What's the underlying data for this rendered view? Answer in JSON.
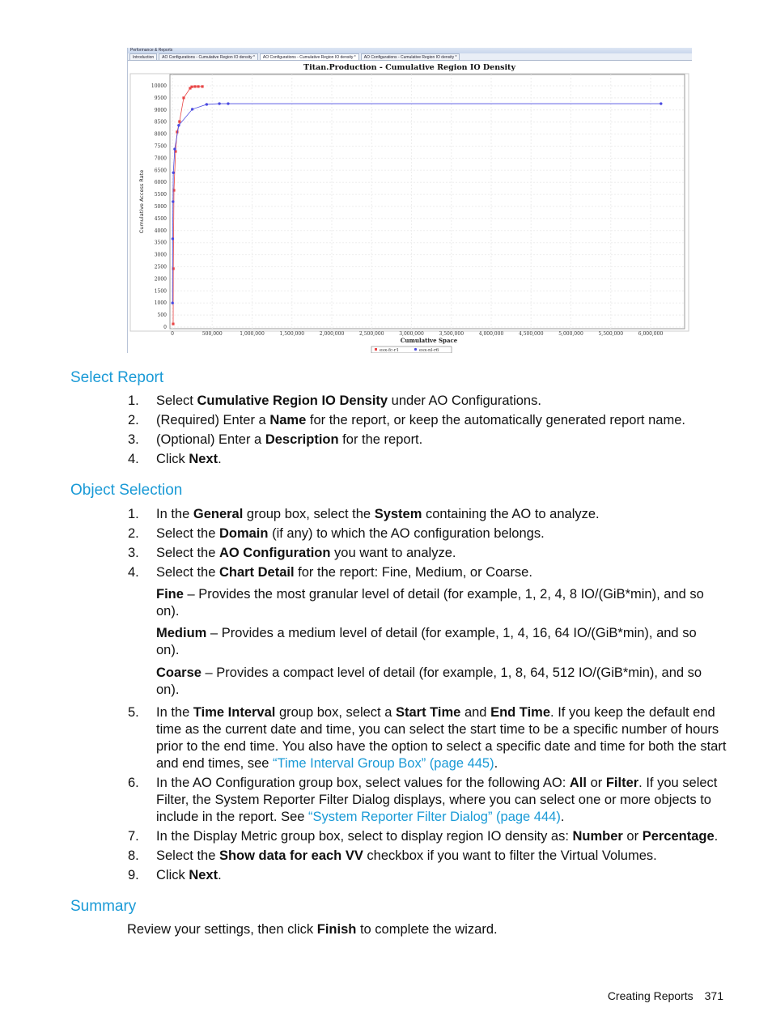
{
  "screenshot": {
    "window_title": "Performance & Reports",
    "tabs": [
      "Introduction",
      "AO Configurations - Cumulative Region IO density *",
      "AO Configurations - Cumulative Region IO density *",
      "AO Configurations - Cumulative Region IO density *"
    ],
    "active_tab": 2
  },
  "chart_data": {
    "type": "line",
    "title": "Titan.Production - Cumulative Region IO Density",
    "xlabel": "Cumulative Space",
    "ylabel": "Cumulative Access Rate",
    "xlim": [
      0,
      6400000
    ],
    "ylim": [
      0,
      10000
    ],
    "xticks": [
      "0",
      "500,000",
      "1,000,000",
      "1,500,000",
      "2,000,000",
      "2,500,000",
      "3,000,000",
      "3,500,000",
      "4,000,000",
      "4,500,000",
      "5,000,000",
      "5,500,000",
      "6,000,000"
    ],
    "yticks": [
      "0",
      "500",
      "1000",
      "1500",
      "2000",
      "2500",
      "3000",
      "3500",
      "4000",
      "4500",
      "5000",
      "5500",
      "6000",
      "6500",
      "7000",
      "7500",
      "8000",
      "8500",
      "9000",
      "9500",
      "10000"
    ],
    "grid": true,
    "legend": "bottom",
    "series": [
      {
        "name": "esx-fc-r1",
        "color": "#e84545",
        "x": [
          10000,
          12000,
          20000,
          40000,
          60000,
          90000,
          142000,
          223000,
          244000,
          284000,
          325000,
          376000
        ],
        "y": [
          130,
          2420,
          5670,
          7280,
          8090,
          8520,
          9500,
          9900,
          9960,
          9970,
          9970,
          9970
        ]
      },
      {
        "name": "esx-nl-r6",
        "color": "#4a4ae0",
        "x": [
          2000,
          4000,
          8000,
          12000,
          30000,
          80000,
          250000,
          430000,
          590000,
          700000,
          6130000
        ],
        "y": [
          1000,
          3660,
          5200,
          6400,
          7380,
          8360,
          9030,
          9230,
          9260,
          9260,
          9260
        ]
      }
    ]
  },
  "sections": [
    {
      "heading": "Select Report",
      "items": [
        [
          {
            "t": "Select  "
          },
          {
            "t": "Cumulative Region IO Density",
            "b": true
          },
          {
            "t": " under AO Configurations."
          }
        ],
        [
          {
            "t": "(Required) Enter a "
          },
          {
            "t": "Name",
            "b": true
          },
          {
            "t": " for the report, or keep the automatically generated report name."
          }
        ],
        [
          {
            "t": "(Optional) Enter a "
          },
          {
            "t": "Description",
            "b": true
          },
          {
            "t": " for the report."
          }
        ],
        [
          {
            "t": "Click "
          },
          {
            "t": "Next",
            "b": true
          },
          {
            "t": "."
          }
        ]
      ]
    },
    {
      "heading": "Object Selection",
      "items": [
        [
          {
            "t": "In the "
          },
          {
            "t": "General",
            "b": true
          },
          {
            "t": " group box, select the "
          },
          {
            "t": "System",
            "b": true
          },
          {
            "t": " containing the AO to analyze."
          }
        ],
        [
          {
            "t": "Select the "
          },
          {
            "t": "Domain",
            "b": true
          },
          {
            "t": " (if any) to which the AO configuration belongs."
          }
        ],
        [
          {
            "t": "Select the "
          },
          {
            "t": "AO Configuration",
            "b": true
          },
          {
            "t": " you want to analyze."
          }
        ],
        [
          {
            "t": "Select the "
          },
          {
            "t": "Chart Detail",
            "b": true
          },
          {
            "t": " for the report: Fine, Medium, or Coarse."
          }
        ],
        [
          {
            "t": "In the "
          },
          {
            "t": "Time Interval",
            "b": true
          },
          {
            "t": " group box, select a "
          },
          {
            "t": "Start Time",
            "b": true
          },
          {
            "t": " and "
          },
          {
            "t": "End Time",
            "b": true
          },
          {
            "t": ". If you keep the default end time as the current date and time, you can select the start time to be a specific number of hours prior to the end time. You also have the option to select a specific date and time for both the start and end times, see "
          },
          {
            "t": "“Time Interval Group Box” (page 445)",
            "l": true
          },
          {
            "t": "."
          }
        ],
        [
          {
            "t": "In the AO Configuration group box, select values for the following AO: "
          },
          {
            "t": "All",
            "b": true
          },
          {
            "t": " or "
          },
          {
            "t": "Filter",
            "b": true
          },
          {
            "t": ". If you select Filter, the System Reporter Filter Dialog displays, where you can select one or more objects to include in the report. See "
          },
          {
            "t": "“System Reporter Filter Dialog” (page 444)",
            "l": true
          },
          {
            "t": "."
          }
        ],
        [
          {
            "t": "In the Display Metric group box, select to display region IO density as: "
          },
          {
            "t": "Number",
            "b": true
          },
          {
            "t": " or "
          },
          {
            "t": "Percentage",
            "b": true
          },
          {
            "t": "."
          }
        ],
        [
          {
            "t": "Select the "
          },
          {
            "t": "Show data for each VV",
            "b": true
          },
          {
            "t": " checkbox if you want to filter the Virtual Volumes."
          }
        ],
        [
          {
            "t": "Click "
          },
          {
            "t": "Next",
            "b": true
          },
          {
            "t": "."
          }
        ]
      ],
      "details": [
        [
          {
            "t": "Fine",
            "b": true
          },
          {
            "t": " – Provides the most granular level of detail (for example, 1, 2, 4, 8 IO/(GiB*min), and so on)."
          }
        ],
        [
          {
            "t": "Medium",
            "b": true
          },
          {
            "t": " – Provides a medium level of detail (for example, 1, 4, 16, 64 IO/(GiB*min), and so on)."
          }
        ],
        [
          {
            "t": "Coarse",
            "b": true
          },
          {
            "t": " – Provides a compact level of detail (for example, 1, 8, 64, 512 IO/(GiB*min), and so on)."
          }
        ]
      ]
    },
    {
      "heading": "Summary",
      "text": [
        {
          "t": "Review your settings, then click "
        },
        {
          "t": "Finish",
          "b": true
        },
        {
          "t": " to complete the wizard."
        }
      ]
    }
  ],
  "footer": {
    "section": "Creating Reports",
    "page": "371"
  },
  "colors": {
    "heading": "#1a9ad6",
    "link": "#1a9ad6"
  }
}
